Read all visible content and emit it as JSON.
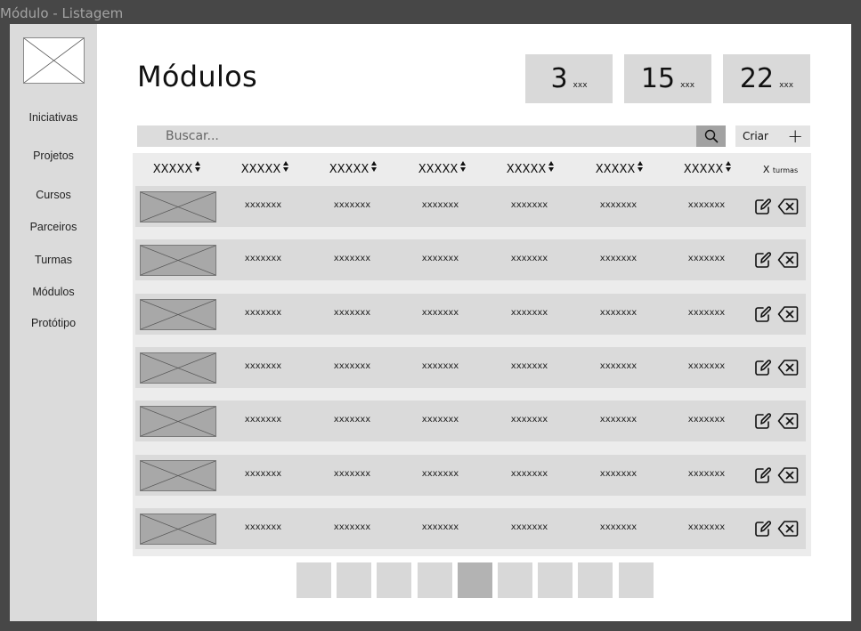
{
  "window": {
    "title": "Módulo - Listagem"
  },
  "sidebar": {
    "items": [
      {
        "label": "Iniciativas"
      },
      {
        "label": "Projetos"
      },
      {
        "label": "Cursos"
      },
      {
        "label": "Parceiros"
      },
      {
        "label": "Turmas"
      },
      {
        "label": "Módulos"
      },
      {
        "label": "Protótipo"
      }
    ]
  },
  "header": {
    "title": "Módulos",
    "stats": [
      {
        "value": "3",
        "unit": "xxx"
      },
      {
        "value": "15",
        "unit": "xxx"
      },
      {
        "value": "22",
        "unit": "xxx"
      }
    ]
  },
  "search": {
    "placeholder": "Buscar..."
  },
  "create": {
    "label": "Criar"
  },
  "table": {
    "columns": [
      "XXXXX",
      "XXXXX",
      "XXXXX",
      "XXXXX",
      "XXXXX",
      "XXXXX",
      "XXXXX"
    ],
    "last_column": {
      "prefix": "X",
      "suffix": "turmas"
    },
    "rows": [
      [
        "xxxxxxx",
        "xxxxxxx",
        "xxxxxxx",
        "xxxxxxx",
        "xxxxxxx",
        "xxxxxxx"
      ],
      [
        "xxxxxxx",
        "xxxxxxx",
        "xxxxxxx",
        "xxxxxxx",
        "xxxxxxx",
        "xxxxxxx"
      ],
      [
        "xxxxxxx",
        "xxxxxxx",
        "xxxxxxx",
        "xxxxxxx",
        "xxxxxxx",
        "xxxxxxx"
      ],
      [
        "xxxxxxx",
        "xxxxxxx",
        "xxxxxxx",
        "xxxxxxx",
        "xxxxxxx",
        "xxxxxxx"
      ],
      [
        "xxxxxxx",
        "xxxxxxx",
        "xxxxxxx",
        "xxxxxxx",
        "xxxxxxx",
        "xxxxxxx"
      ],
      [
        "xxxxxxx",
        "xxxxxxx",
        "xxxxxxx",
        "xxxxxxx",
        "xxxxxxx",
        "xxxxxxx"
      ],
      [
        "xxxxxxx",
        "xxxxxxx",
        "xxxxxxx",
        "xxxxxxx",
        "xxxxxxx",
        "xxxxxxx"
      ]
    ]
  },
  "icons": {
    "logo": "image-placeholder-icon",
    "search": "search-icon",
    "create": "plus-icon",
    "sort": "sort-icon",
    "edit": "edit-icon",
    "delete": "delete-icon",
    "thumbnail": "image-placeholder-icon"
  },
  "pagination": {
    "pages": 9,
    "active_page": 5
  },
  "colors": {
    "frame": "#474747",
    "sidebar": "#dbdbdb",
    "row": "#dadada",
    "table_bg": "#ececec",
    "active_page": "#b3b3b3",
    "page": "#d8d8d8"
  }
}
